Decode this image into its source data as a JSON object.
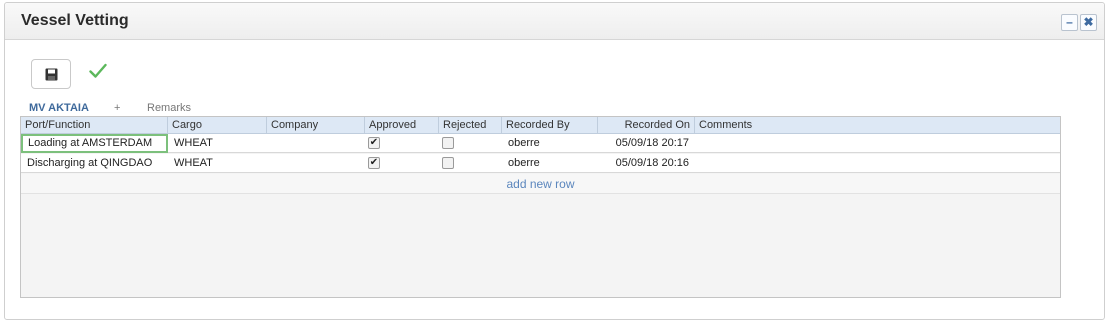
{
  "panel": {
    "title": "Vessel Vetting",
    "minimize_glyph": "–",
    "close_glyph": "✖"
  },
  "toolbar": {
    "save_icon": "floppy-disk-icon",
    "confirm_icon": "checkmark-icon",
    "confirm_color": "#5cb85c"
  },
  "tabs": [
    {
      "label": "MV AKTAIA",
      "active": true
    },
    {
      "label": "+",
      "active": false
    },
    {
      "label": "Remarks",
      "active": false
    }
  ],
  "grid": {
    "columns": [
      "Port/Function",
      "Cargo",
      "Company",
      "Approved",
      "Rejected",
      "Recorded By",
      "Recorded On",
      "Comments"
    ],
    "rows": [
      {
        "port_function": "Loading at AMSTERDAM",
        "cargo": "WHEAT",
        "company": "",
        "approved": true,
        "rejected": false,
        "recorded_by": "oberre",
        "recorded_on": "05/09/18 20:17",
        "comments": ""
      },
      {
        "port_function": "Discharging at QINGDAO",
        "cargo": "WHEAT",
        "company": "",
        "approved": true,
        "rejected": false,
        "recorded_by": "oberre",
        "recorded_on": "05/09/18 20:16",
        "comments": ""
      }
    ],
    "add_row_label": "add new row"
  },
  "colors": {
    "header_bg": "#dde8f5",
    "accent": "#3f6a9c",
    "selection": "#7cc07c"
  }
}
